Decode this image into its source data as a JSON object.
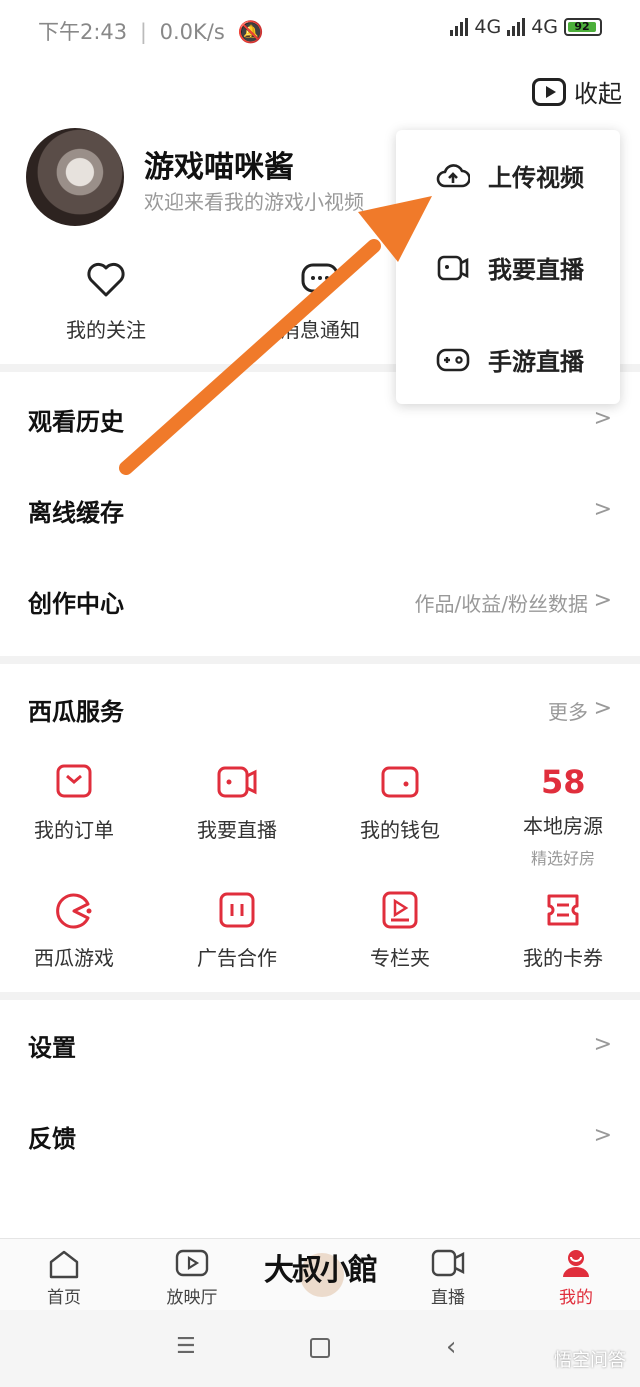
{
  "status_bar": {
    "time": "下午2:43",
    "speed": "0.0K/s",
    "network1": "4G",
    "network2": "4G",
    "battery": "92"
  },
  "collapse_label": "收起",
  "profile": {
    "name": "游戏喵咪酱",
    "description": "欢迎来看我的游戏小视频"
  },
  "quick_links": [
    {
      "label": "我的关注",
      "icon": "heart-icon"
    },
    {
      "label": "消息通知",
      "icon": "message-icon"
    }
  ],
  "popup_menu": [
    {
      "label": "上传视频",
      "icon": "upload-cloud-icon"
    },
    {
      "label": "我要直播",
      "icon": "camera-icon"
    },
    {
      "label": "手游直播",
      "icon": "gamepad-icon"
    }
  ],
  "menu_rows": [
    {
      "label": "观看历史",
      "extra": ""
    },
    {
      "label": "离线缓存",
      "extra": ""
    },
    {
      "label": "创作中心",
      "extra": "作品/收益/粉丝数据"
    }
  ],
  "services": {
    "title": "西瓜服务",
    "more": "更多",
    "items": [
      {
        "label": "我的订单",
        "sub": "",
        "icon": "order-icon"
      },
      {
        "label": "我要直播",
        "sub": "",
        "icon": "live-camera-icon"
      },
      {
        "label": "我的钱包",
        "sub": "",
        "icon": "wallet-icon"
      },
      {
        "label": "本地房源",
        "sub": "精选好房",
        "icon": "58-icon",
        "icon_text": "58"
      },
      {
        "label": "西瓜游戏",
        "sub": "",
        "icon": "game-icon"
      },
      {
        "label": "广告合作",
        "sub": "",
        "icon": "ad-icon"
      },
      {
        "label": "专栏夹",
        "sub": "",
        "icon": "column-icon"
      },
      {
        "label": "我的卡券",
        "sub": "",
        "icon": "coupon-icon"
      }
    ]
  },
  "bottom_rows": [
    {
      "label": "设置"
    },
    {
      "label": "反馈"
    }
  ],
  "bottom_nav": [
    {
      "label": "首页",
      "icon": "home-icon"
    },
    {
      "label": "放映厅",
      "icon": "play-icon"
    },
    {
      "label": "直播",
      "icon": "live-icon"
    },
    {
      "label": "我的",
      "icon": "profile-icon"
    }
  ],
  "logo_text": "大叔小館",
  "watermark": "悟空问答",
  "colors": {
    "accent": "#e02e3c",
    "arrow": "#f07a2a"
  }
}
